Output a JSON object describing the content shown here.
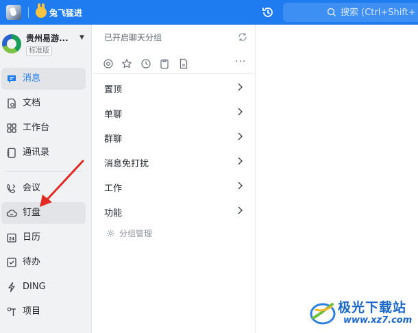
{
  "topbar": {
    "profile_name": "兔飞猛进",
    "search_placeholder": "搜索 (Ctrl+Shift+",
    "accent_color": "#1f7cf0"
  },
  "sidebar": {
    "org_name": "贵州易游...",
    "org_badge": "标准版",
    "items": [
      {
        "label": "消息",
        "icon": "message-icon",
        "active": true
      },
      {
        "label": "文档",
        "icon": "document-icon"
      },
      {
        "label": "工作台",
        "icon": "workbench-icon"
      },
      {
        "label": "通讯录",
        "icon": "contacts-icon"
      },
      {
        "label": "会议",
        "icon": "meeting-icon"
      },
      {
        "label": "钉盘",
        "icon": "cloud-disk-icon"
      },
      {
        "label": "日历",
        "icon": "calendar-icon"
      },
      {
        "label": "待办",
        "icon": "todo-icon"
      },
      {
        "label": "DING",
        "icon": "ding-icon"
      },
      {
        "label": "项目",
        "icon": "project-icon"
      }
    ]
  },
  "groups": {
    "header": "已开启聊天分组",
    "filters": [
      "mention-icon",
      "star-icon",
      "clock-icon",
      "clipboard-icon",
      "file-icon"
    ],
    "items": [
      {
        "label": "置顶"
      },
      {
        "label": "单聊"
      },
      {
        "label": "群聊"
      },
      {
        "label": "消息免打扰"
      },
      {
        "label": "工作"
      },
      {
        "label": "功能"
      }
    ],
    "manage_label": "分组管理"
  },
  "watermark": {
    "title": "极光下载站",
    "url": "www.xz7.com"
  }
}
